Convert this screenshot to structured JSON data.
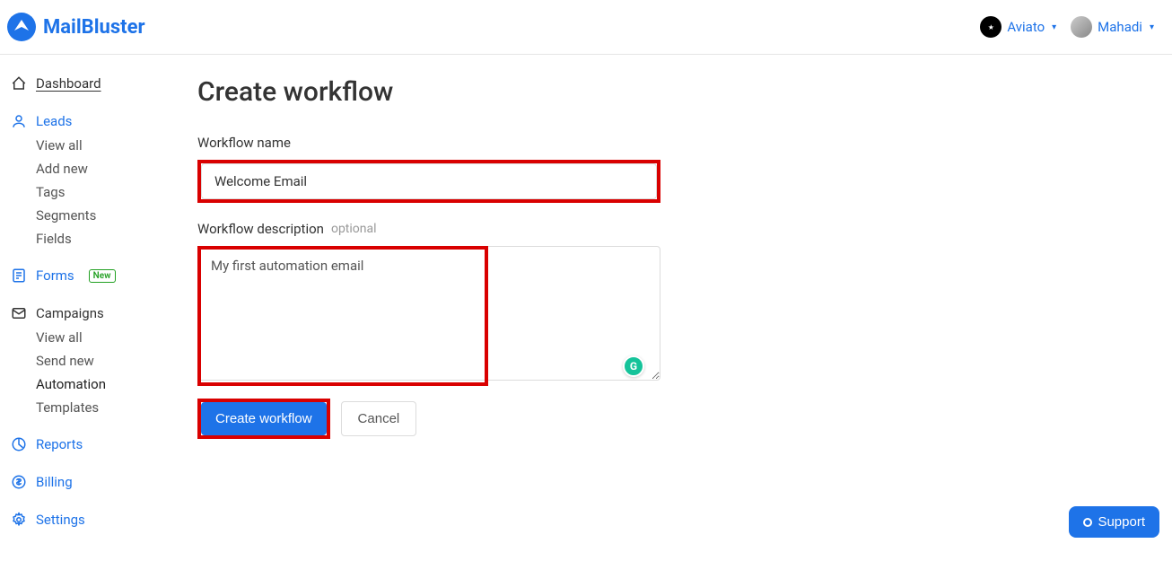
{
  "header": {
    "brand": "MailBluster",
    "org": "Aviato",
    "user": "Mahadi"
  },
  "sidebar": {
    "dashboard": "Dashboard",
    "leads": {
      "label": "Leads",
      "items": [
        "View all",
        "Add new",
        "Tags",
        "Segments",
        "Fields"
      ]
    },
    "forms": {
      "label": "Forms",
      "badge": "New"
    },
    "campaigns": {
      "label": "Campaigns",
      "items": [
        "View all",
        "Send new",
        "Automation",
        "Templates"
      ]
    },
    "reports": "Reports",
    "billing": "Billing",
    "settings": "Settings"
  },
  "main": {
    "title": "Create workflow",
    "name_label": "Workflow name",
    "name_value": "Welcome Email",
    "desc_label": "Workflow description",
    "desc_optional": "optional",
    "desc_value": "My first automation email",
    "create_btn": "Create workflow",
    "cancel_btn": "Cancel"
  },
  "support": "Support"
}
